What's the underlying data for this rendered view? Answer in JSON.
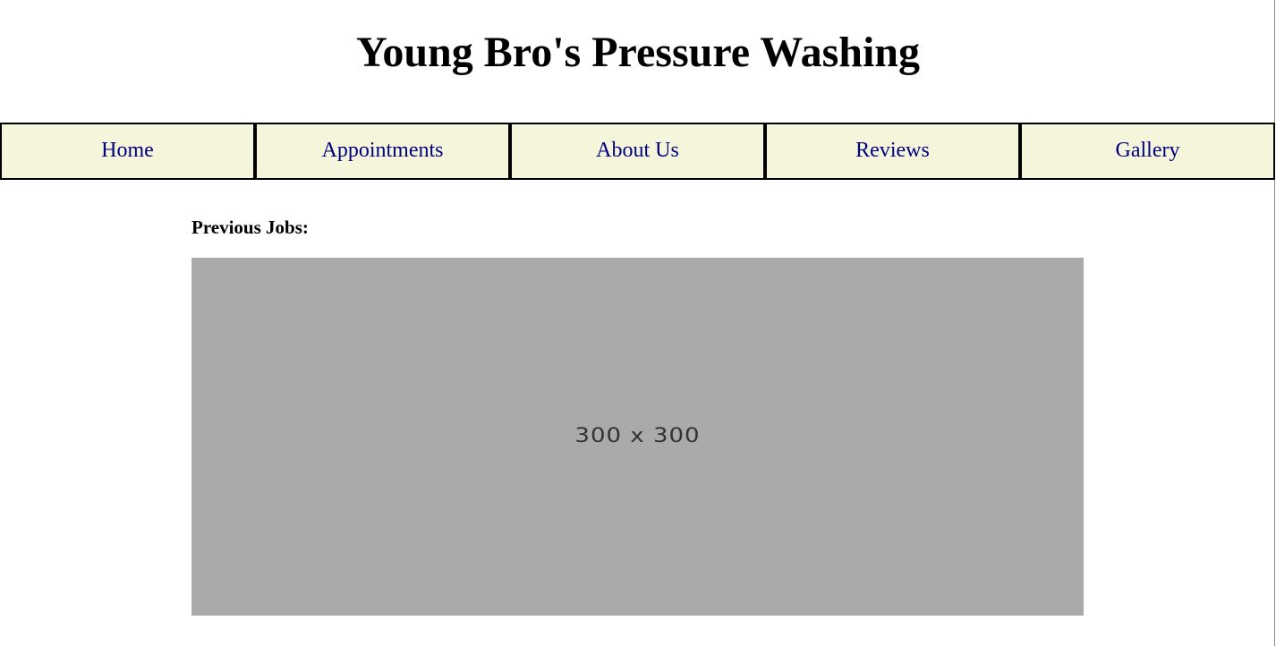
{
  "header": {
    "title": "Young Bro's Pressure Washing"
  },
  "nav": {
    "items": [
      {
        "label": "Home"
      },
      {
        "label": "Appointments"
      },
      {
        "label": "About Us"
      },
      {
        "label": "Reviews"
      },
      {
        "label": "Gallery"
      }
    ]
  },
  "main": {
    "section_heading": "Previous Jobs:",
    "image": {
      "placeholder_text": "300 x 300"
    }
  },
  "colors": {
    "nav_background": "#f5f5dc",
    "nav_link": "#000080",
    "nav_border": "#000000",
    "placeholder_background": "#aaaaaa"
  }
}
